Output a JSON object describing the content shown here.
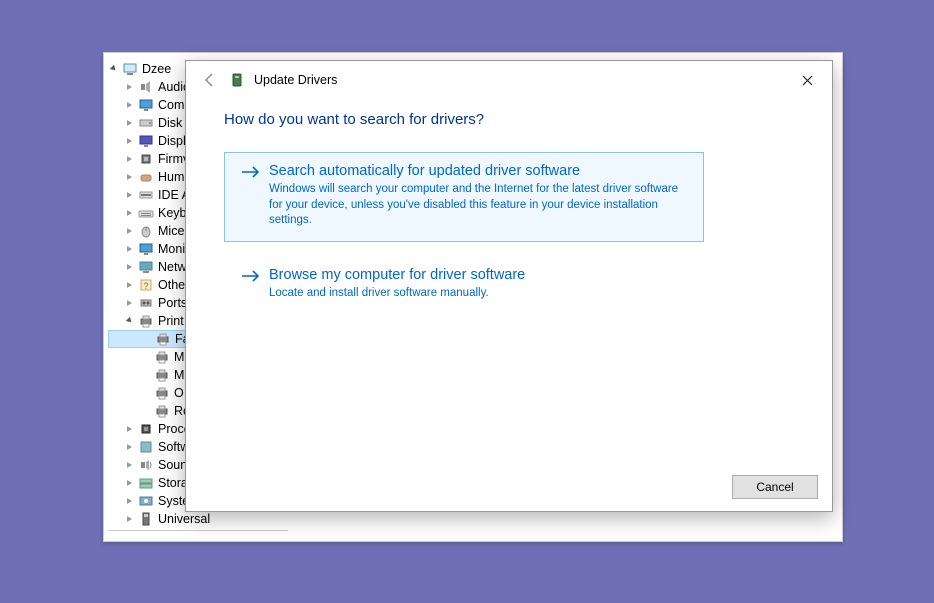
{
  "tree": {
    "root": "Dzee",
    "items": [
      {
        "label": "Audio",
        "icon": "speaker"
      },
      {
        "label": "Comp",
        "icon": "monitor"
      },
      {
        "label": "Disk d",
        "icon": "disk"
      },
      {
        "label": "Displa",
        "icon": "display"
      },
      {
        "label": "Firmv",
        "icon": "chip"
      },
      {
        "label": "Huma",
        "icon": "hid"
      },
      {
        "label": "IDE A",
        "icon": "ide"
      },
      {
        "label": "Keybo",
        "icon": "keyboard"
      },
      {
        "label": "Mice",
        "icon": "mouse"
      },
      {
        "label": "Moni",
        "icon": "monitor"
      },
      {
        "label": "Netw",
        "icon": "network"
      },
      {
        "label": "Other",
        "icon": "other"
      },
      {
        "label": "Ports",
        "icon": "port"
      },
      {
        "label": "Print",
        "icon": "printer",
        "expanded": true,
        "children": [
          {
            "label": "Fa",
            "icon": "printer",
            "selected": true
          },
          {
            "label": "M",
            "icon": "printer"
          },
          {
            "label": "M",
            "icon": "printer"
          },
          {
            "label": "O",
            "icon": "printer"
          },
          {
            "label": "Ro",
            "icon": "printer"
          }
        ]
      },
      {
        "label": "Proce",
        "icon": "cpu"
      },
      {
        "label": "Softw",
        "icon": "software"
      },
      {
        "label": "Souno",
        "icon": "sound"
      },
      {
        "label": "Storag",
        "icon": "storage"
      },
      {
        "label": "Syster",
        "icon": "system"
      },
      {
        "label": "Universal",
        "icon": "usb"
      }
    ]
  },
  "dialog": {
    "title": "Update Drivers",
    "heading": "How do you want to search for drivers?",
    "options": [
      {
        "title": "Search automatically for updated driver software",
        "desc": "Windows will search your computer and the Internet for the latest driver software for your device, unless you've disabled this feature in your device installation settings."
      },
      {
        "title": "Browse my computer for driver software",
        "desc": "Locate and install driver software manually."
      }
    ],
    "cancel_label": "Cancel"
  }
}
